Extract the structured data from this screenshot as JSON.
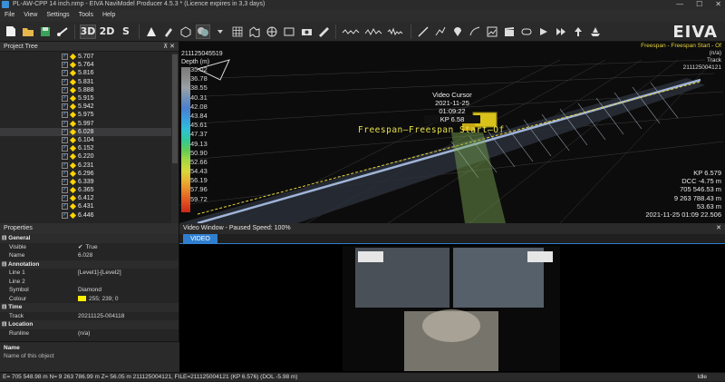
{
  "window": {
    "title": "PL-AW-CPP 14 inch.nmp - EIVA NaviModel Producer 4.5.3 * (Licence expires in 3,3 days)",
    "controls": [
      "—",
      "☐",
      "✕"
    ]
  },
  "menu": [
    "File",
    "View",
    "Settings",
    "Tools",
    "Help"
  ],
  "toolbar": {
    "mode_3d": "3D",
    "mode_2d": "2D",
    "mode_s": "S",
    "logo": "EIVA"
  },
  "project_tree": {
    "title": "Project Tree",
    "items": [
      {
        "label": "5.707",
        "selected": false
      },
      {
        "label": "5.764",
        "selected": false
      },
      {
        "label": "5.816",
        "selected": false
      },
      {
        "label": "5.831",
        "selected": false
      },
      {
        "label": "5.888",
        "selected": false
      },
      {
        "label": "5.915",
        "selected": false
      },
      {
        "label": "5.942",
        "selected": false
      },
      {
        "label": "5.975",
        "selected": false
      },
      {
        "label": "5.997",
        "selected": false
      },
      {
        "label": "6.028",
        "selected": true
      },
      {
        "label": "6.104",
        "selected": false
      },
      {
        "label": "6.152",
        "selected": false
      },
      {
        "label": "6.220",
        "selected": false
      },
      {
        "label": "6.231",
        "selected": false
      },
      {
        "label": "6.296",
        "selected": false
      },
      {
        "label": "6.339",
        "selected": false
      },
      {
        "label": "6.365",
        "selected": false
      },
      {
        "label": "6.412",
        "selected": false
      },
      {
        "label": "6.431",
        "selected": false
      },
      {
        "label": "6.446",
        "selected": false
      }
    ]
  },
  "properties": {
    "title": "Properties",
    "general": "General",
    "visible_key": "Visible",
    "visible_val": "True",
    "name_key": "Name",
    "name_val": "6.028",
    "annotation": "Annotation",
    "line1_key": "Line 1",
    "line1_val": "[Level1]-[Level2]",
    "line2_key": "Line 2",
    "symbol_key": "Symbol",
    "symbol_val": "Diamond",
    "colour_key": "Colour",
    "colour_val": "255; 239; 0",
    "time": "Time",
    "track_key": "Track",
    "track_val": "20211125-004118",
    "location": "Location",
    "runline_key": "Runline",
    "runline_val": "(n/a)",
    "desc_name": "Name",
    "desc_text": "Name of this object"
  },
  "view3d": {
    "legend_title": "Depth (m)",
    "legend_top_id": "211125045519",
    "legend_values": [
      "35.02",
      "36.78",
      "38.55",
      "40.31",
      "42.08",
      "43.84",
      "45.61",
      "47.37",
      "49.13",
      "50.90",
      "52.66",
      "54.43",
      "56.19",
      "57.96",
      "59.72"
    ],
    "legend_colors": [
      "#7a7a7a",
      "#8a8a8a",
      "#9aa0a8",
      "#6f8fb8",
      "#4a7fd0",
      "#3b9ee0",
      "#2fc0d8",
      "#30c89a",
      "#60cc58",
      "#a6d840",
      "#d8d83a",
      "#e8b030",
      "#e88028",
      "#e05020",
      "#c82818"
    ],
    "top_right": {
      "line1": "Freespan - Freespan Start - Of",
      "line2": "(n/a)",
      "line3": "Track",
      "line4": "211125004121"
    },
    "video_cursor": {
      "title": "Video Cursor",
      "date": "2021-11-25",
      "time": "01:09:22",
      "kp": "KP 6.58"
    },
    "freespan_label": "Freespan–Freespan Start–Of",
    "info": {
      "kp": "KP 6.579",
      "dcc": "DCC -4.75 m",
      "e": "705 546.53 m",
      "n": "9 263 788.43 m",
      "z": "53.63 m",
      "ts": "2021-11-25 01:09 22.506"
    }
  },
  "video": {
    "title": "Video Window - Paused Speed: 100%",
    "tab": "VIDEO",
    "close": "✕"
  },
  "status": {
    "text": "E= 705 548.98 m N= 9 263 786.99 m Z= 56.05 m 211125004121, FILE=211125004121 (KP 6.576) (DOL -5.98 m)",
    "state": "Idle"
  }
}
